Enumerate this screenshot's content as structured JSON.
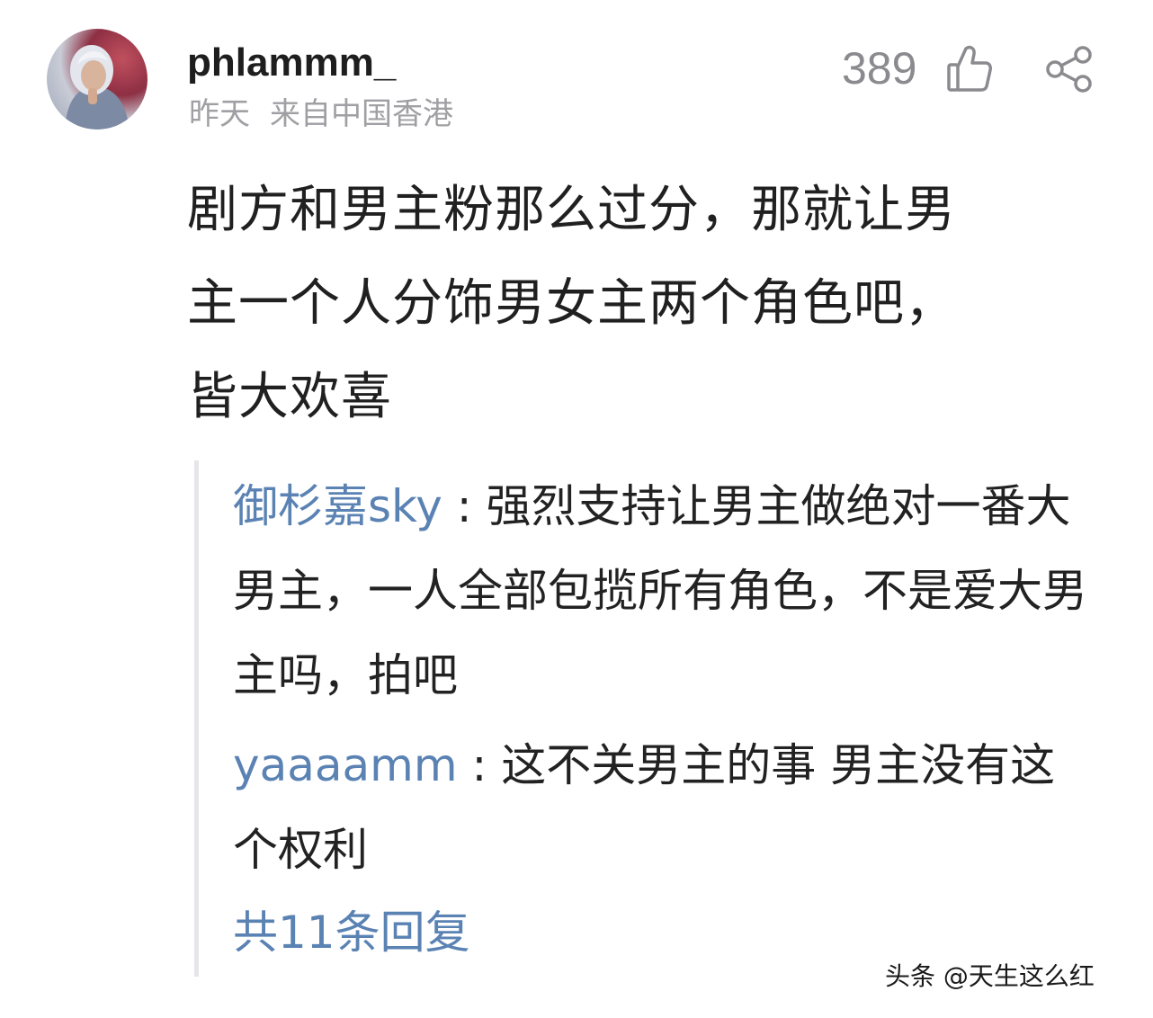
{
  "comment": {
    "username": "phlammm_",
    "time": "昨天",
    "location": "来自中国香港",
    "like_count": "389",
    "like_icon": "thumbs-up-icon",
    "share_icon": "share-icon",
    "text_lines": [
      "剧方和男主粉那么过分，那就让男",
      "主一个人分饰男女主两个角色吧，",
      "皆大欢喜"
    ]
  },
  "replies": {
    "items": [
      {
        "user": "御杉嘉sky",
        "separator": " : ",
        "text": "强烈支持让男主做绝对一番大男主，一人全部包揽所有角色，不是爱大男主吗，拍吧"
      },
      {
        "user": "yaaaamm",
        "separator": " : ",
        "text": "这不关男主的事 男主没有这个权利"
      }
    ],
    "more_label": "共11条回复"
  },
  "watermark": "头条 @天生这么红",
  "colors": {
    "reply_user": "#5a82b3",
    "meta": "#a0a0a4",
    "icon": "#8b8b8f"
  }
}
